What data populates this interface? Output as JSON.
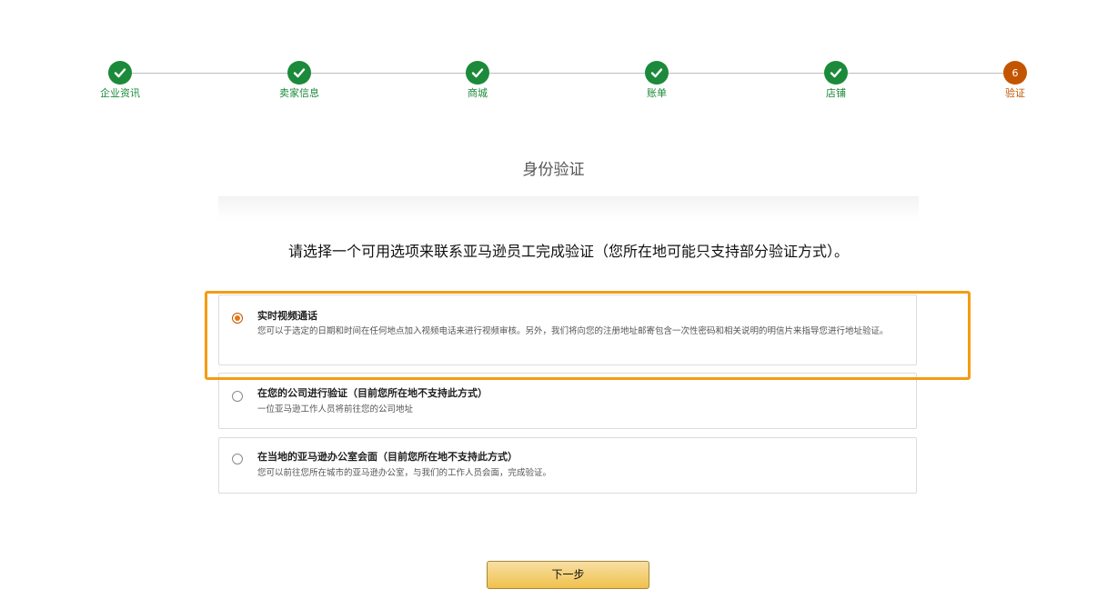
{
  "stepper": {
    "steps": [
      {
        "label": "企业资讯",
        "status": "done",
        "icon": "check-icon"
      },
      {
        "label": "卖家信息",
        "status": "done",
        "icon": "check-icon"
      },
      {
        "label": "商城",
        "status": "done",
        "icon": "check-icon"
      },
      {
        "label": "账单",
        "status": "done",
        "icon": "check-icon"
      },
      {
        "label": "店铺",
        "status": "done",
        "icon": "check-icon"
      },
      {
        "label": "验证",
        "status": "current",
        "number": "6"
      }
    ],
    "colors": {
      "done": "#1b8a3a",
      "current": "#c45500"
    }
  },
  "page": {
    "title": "身份验证",
    "instruction": "请选择一个可用选项来联系亚马逊员工完成验证（您所在地可能只支持部分验证方式）。"
  },
  "options": [
    {
      "title": "实时视频通话",
      "description": "您可以于选定的日期和时间在任何地点加入视频电话来进行视频审核。另外，我们将向您的注册地址邮寄包含一次性密码和相关说明的明信片来指导您进行地址验证。",
      "selected": true
    },
    {
      "title": "在您的公司进行验证（目前您所在地不支持此方式）",
      "description": "一位亚马逊工作人员将前往您的公司地址",
      "selected": false
    },
    {
      "title": "在当地的亚马逊办公室会面（目前您所在地不支持此方式）",
      "description": "您可以前往您所在城市的亚马逊办公室，与我们的工作人员会面，完成验证。",
      "selected": false
    }
  ],
  "highlight_color": "#f39c12",
  "next_button": {
    "label": "下一步"
  }
}
